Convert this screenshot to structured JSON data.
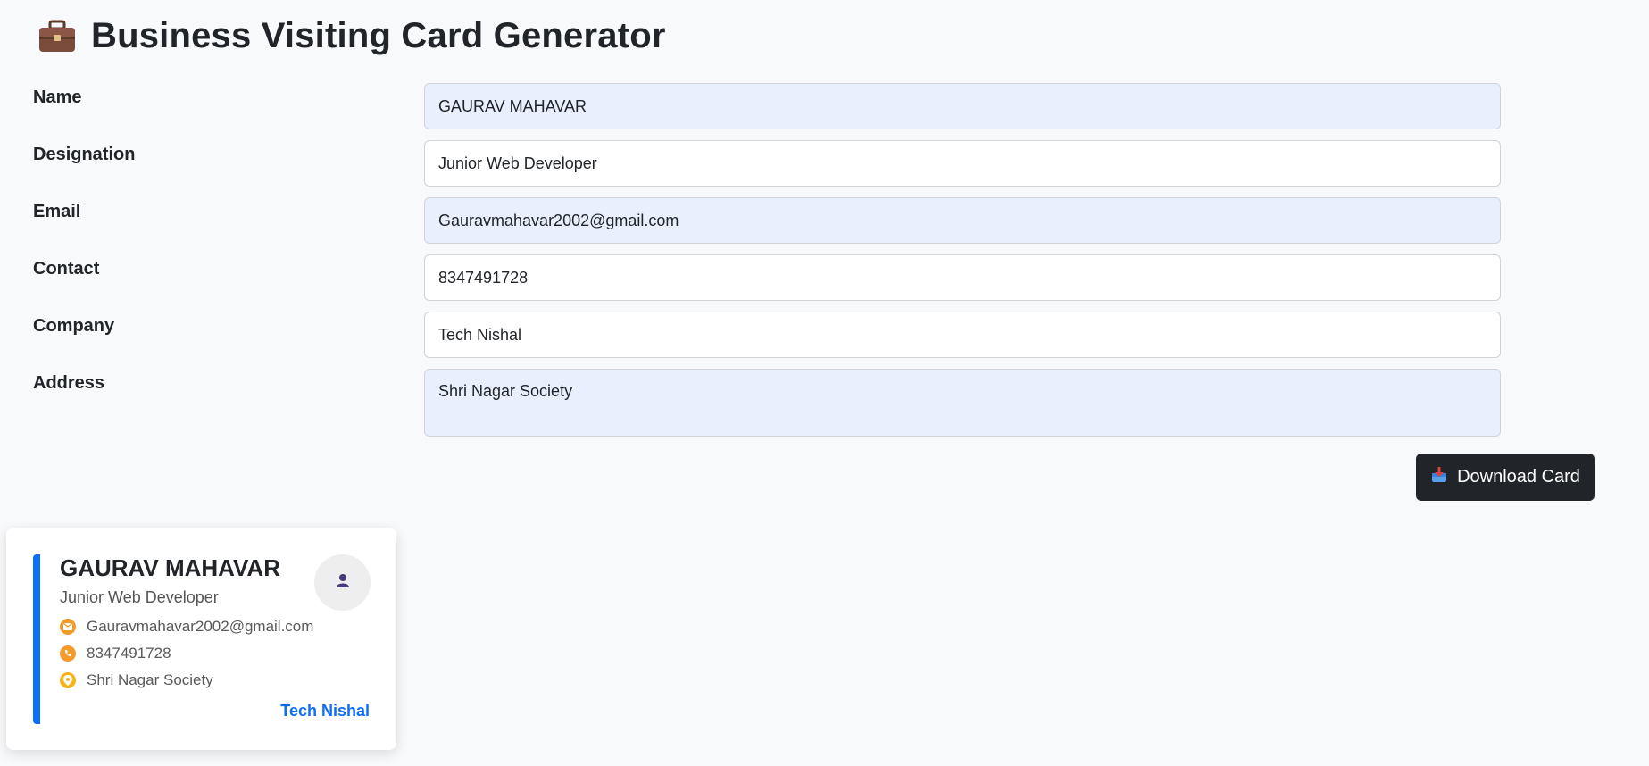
{
  "header": {
    "title": "Business Visiting Card Generator",
    "icon": "briefcase-icon"
  },
  "form": {
    "fields": [
      {
        "label": "Name",
        "value": "GAURAV MAHAVAR"
      },
      {
        "label": "Designation",
        "value": "Junior Web Developer"
      },
      {
        "label": "Email",
        "value": "Gauravmahavar2002@gmail.com"
      },
      {
        "label": "Contact",
        "value": "8347491728"
      },
      {
        "label": "Company",
        "value": "Tech Nishal"
      },
      {
        "label": "Address",
        "value": "Shri Nagar Society"
      }
    ]
  },
  "download": {
    "label": "Download Card",
    "icon": "inbox-tray-icon"
  },
  "card": {
    "name": "GAURAV MAHAVAR",
    "designation": "Junior Web Developer",
    "email": "Gauravmahavar2002@gmail.com",
    "contact": "8347491728",
    "address": "Shri Nagar Society",
    "company": "Tech Nishal",
    "avatar_icon": "person-icon"
  },
  "colors": {
    "accent": "#0d6efd",
    "button_bg": "#212529",
    "icon_orange": "#f39c2c",
    "autofill_bg": "#e8f0fe"
  }
}
